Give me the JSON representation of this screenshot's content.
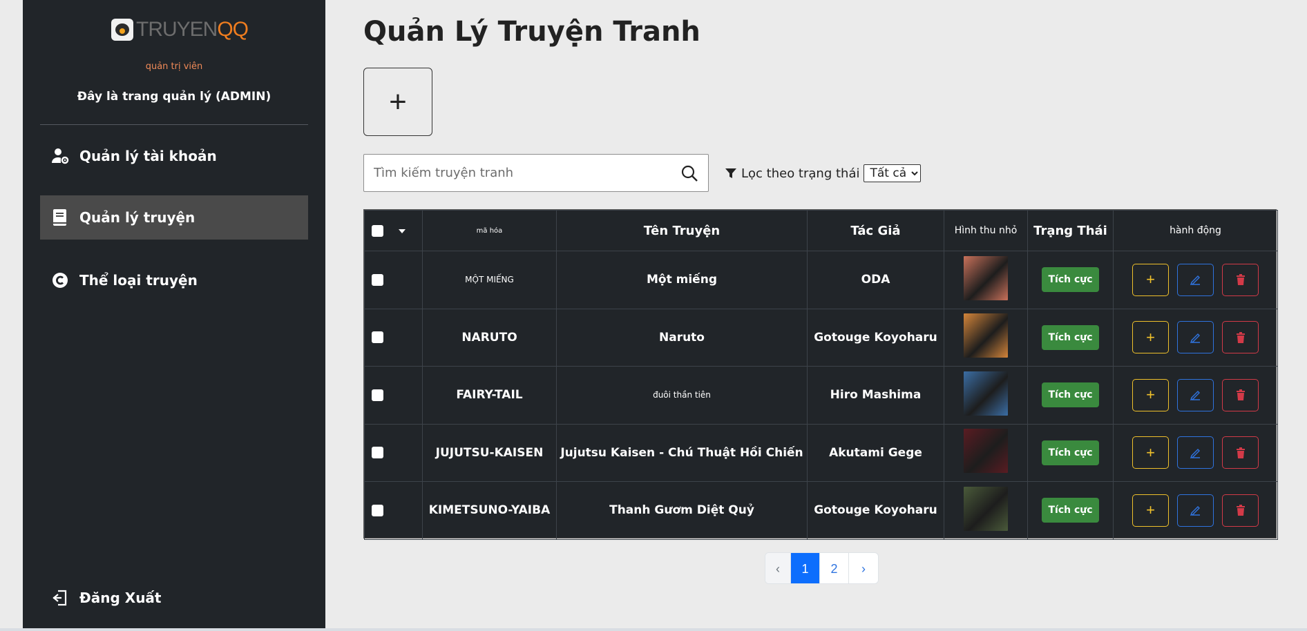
{
  "sidebar": {
    "logo_part1": "TRUYEN",
    "logo_part2": "QQ",
    "role": "quản trị viên",
    "description": "Đây là trang quản lý (ADMIN)",
    "items": [
      {
        "label": "Quản lý tài khoản",
        "icon": "user-gear-icon",
        "active": false
      },
      {
        "label": "Quản lý truyện",
        "icon": "book-icon",
        "active": true
      },
      {
        "label": "Thể loại truyện",
        "icon": "copyright-icon",
        "active": false
      }
    ],
    "logout_label": "Đăng Xuất"
  },
  "main": {
    "title": "Quản Lý Truyện Tranh",
    "add_label": "+",
    "search_placeholder": "Tìm kiếm truyện tranh",
    "filter_label": "Lọc theo trạng thái",
    "filter_selected": "Tất cả"
  },
  "table": {
    "headers": {
      "code": "mã hóa",
      "name": "Tên Truyện",
      "author": "Tác Giả",
      "thumb": "Hình thu nhỏ",
      "status": "Trạng Thái",
      "actions": "hành động"
    },
    "rows": [
      {
        "code": "MỘT MIẾNG",
        "name": "Một miếng",
        "author": "ODA",
        "status": "Tích cực",
        "thumb_color": "#c9715a"
      },
      {
        "code": "NARUTO",
        "name": "Naruto",
        "author": "Gotouge Koyoharu",
        "status": "Tích cực",
        "thumb_color": "#d4853a"
      },
      {
        "code": "FAIRY-TAIL",
        "name": "đuôi thần tiên",
        "author": "Hiro Mashima",
        "status": "Tích cực",
        "thumb_color": "#3b6ea5"
      },
      {
        "code": "JUJUTSU-KAISEN",
        "name": "Jujutsu Kaisen - Chú Thuật Hồi Chiến",
        "author": "Akutami Gege",
        "status": "Tích cực",
        "thumb_color": "#5a1c22"
      },
      {
        "code": "KIMETSUNO-YAIBA",
        "name": "Thanh Gươm Diệt Quỷ",
        "author": "Gotouge Koyoharu",
        "status": "Tích cực",
        "thumb_color": "#4a5a3a"
      }
    ]
  },
  "pagination": {
    "prev": "‹",
    "pages": [
      "1",
      "2"
    ],
    "current": "1",
    "next": "›"
  },
  "colors": {
    "sidebar_bg": "#212529",
    "status_green": "#3a8a3e",
    "add_yellow": "#f0c12b",
    "edit_blue": "#2f74e0",
    "delete_red": "#d33a48",
    "page_active": "#0d6efd"
  }
}
